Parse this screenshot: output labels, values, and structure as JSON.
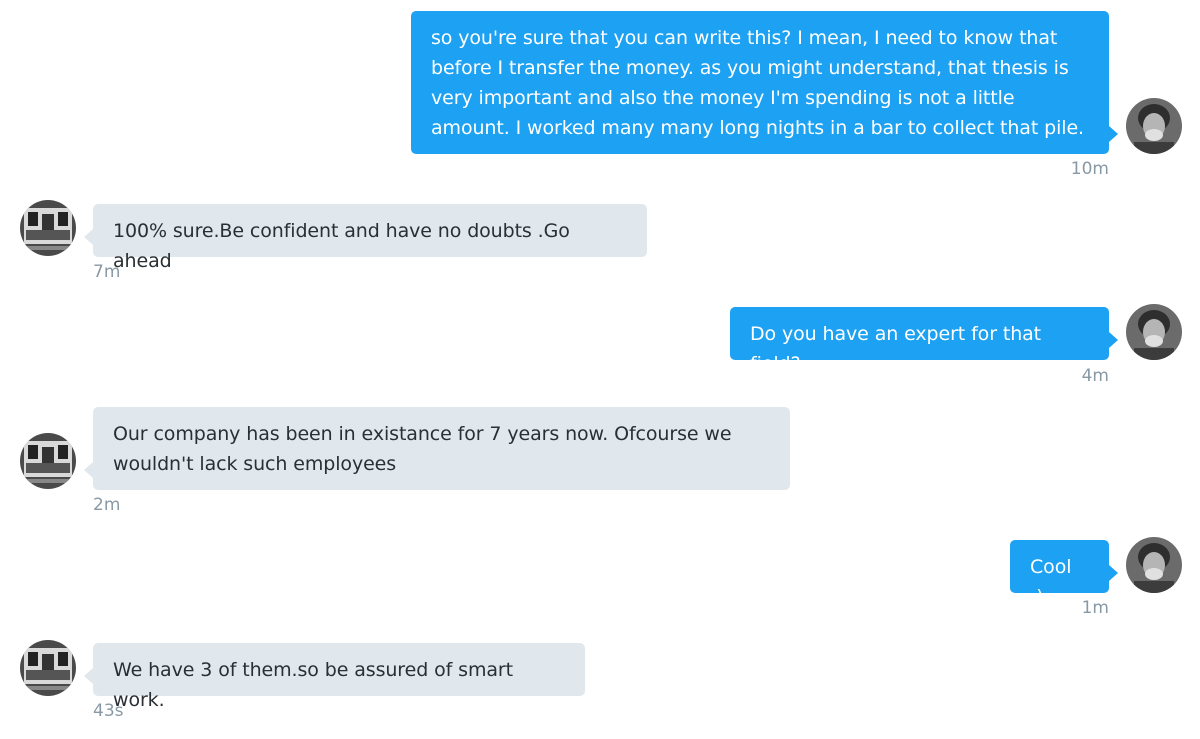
{
  "messages": [
    {
      "direction": "outgoing",
      "text": "so you're sure that you can write this? I mean, I need to know that\nbefore I transfer the money. as you might understand, that thesis is\nvery important and also the money I'm spending is not a little\namount. I worked many many long nights in a bar to collect that pile.",
      "time": "10m",
      "avatar": "user-avatar"
    },
    {
      "direction": "incoming",
      "text": "100% sure.Be confident and have no doubts .Go ahead",
      "time": "7m",
      "avatar": "contact-avatar"
    },
    {
      "direction": "outgoing",
      "text": "Do you have an expert for that field?",
      "time": "4m",
      "avatar": "user-avatar"
    },
    {
      "direction": "incoming",
      "text": "Our company has been in existance for 7 years now. Ofcourse we\nwouldn't lack such employees",
      "time": "2m",
      "avatar": "contact-avatar"
    },
    {
      "direction": "outgoing",
      "text": "Cool :)",
      "time": "1m",
      "avatar": "user-avatar"
    },
    {
      "direction": "incoming",
      "text": "We have 3 of them.so be assured of smart work.",
      "time": "43s",
      "avatar": "contact-avatar"
    }
  ],
  "colors": {
    "outgoing_bubble": "#1da1f2",
    "incoming_bubble": "#e1e8ed",
    "timestamp": "#8899a6"
  }
}
